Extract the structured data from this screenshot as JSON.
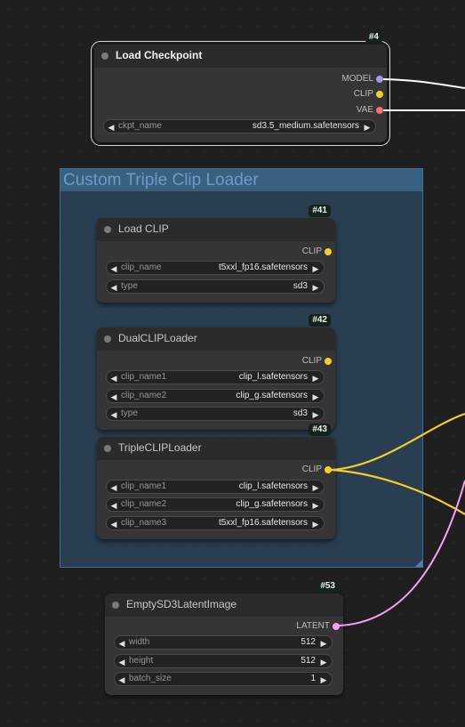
{
  "colors": {
    "model": "#a59ae6",
    "clip": "#f7cd2c",
    "vae": "#ff6e6e",
    "latent": "#ff9cf9",
    "group_bg": "#335f84"
  },
  "group": {
    "title": "Custom Triple Clip Loader"
  },
  "nodes": {
    "load_checkpoint": {
      "id": "#4",
      "title": "Load Checkpoint",
      "outputs": [
        "MODEL",
        "CLIP",
        "VAE"
      ],
      "widgets": [
        {
          "name": "ckpt_name",
          "value": "sd3.5_medium.safetensors"
        }
      ]
    },
    "load_clip": {
      "id": "#41",
      "title": "Load CLIP",
      "outputs": [
        "CLIP"
      ],
      "widgets": [
        {
          "name": "clip_name",
          "value": "t5xxl_fp16.safetensors"
        },
        {
          "name": "type",
          "value": "sd3"
        }
      ]
    },
    "dual_clip_loader": {
      "id": "#42",
      "title": "DualCLIPLoader",
      "outputs": [
        "CLIP"
      ],
      "widgets": [
        {
          "name": "clip_name1",
          "value": "clip_l.safetensors"
        },
        {
          "name": "clip_name2",
          "value": "clip_g.safetensors"
        },
        {
          "name": "type",
          "value": "sd3"
        }
      ]
    },
    "triple_clip_loader": {
      "id": "#43",
      "title": "TripleCLIPLoader",
      "outputs": [
        "CLIP"
      ],
      "widgets": [
        {
          "name": "clip_name1",
          "value": "clip_l.safetensors"
        },
        {
          "name": "clip_name2",
          "value": "clip_g.safetensors"
        },
        {
          "name": "clip_name3",
          "value": "t5xxl_fp16.safetensors"
        }
      ]
    },
    "empty_latent": {
      "id": "#53",
      "title": "EmptySD3LatentImage",
      "outputs": [
        "LATENT"
      ],
      "widgets": [
        {
          "name": "width",
          "value": "512"
        },
        {
          "name": "height",
          "value": "512"
        },
        {
          "name": "batch_size",
          "value": "1"
        }
      ]
    }
  }
}
